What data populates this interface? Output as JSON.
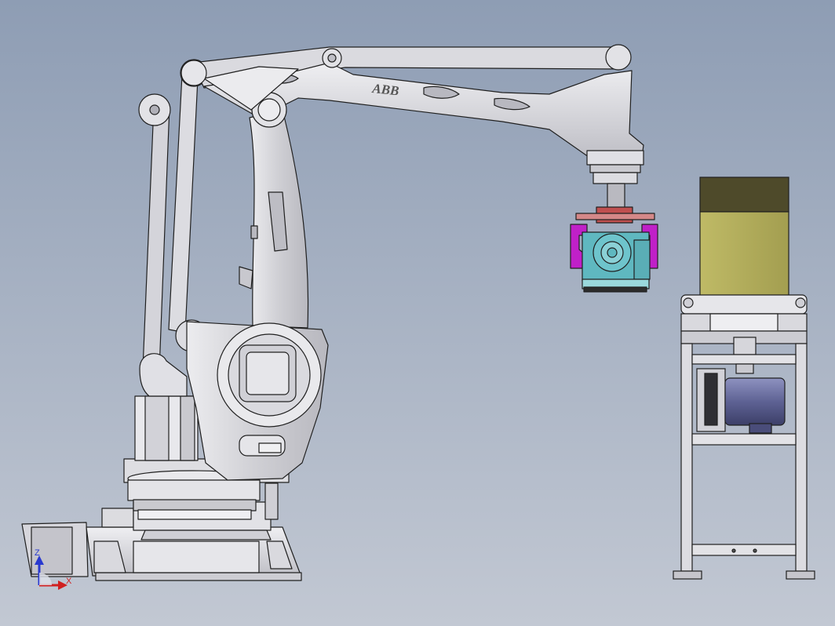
{
  "scene": {
    "brand_logo_text": "ABB",
    "triad": {
      "z": "Z",
      "x": "X"
    },
    "colors": {
      "bg_top": "#8e9db4",
      "bg_bottom": "#c2c8d3",
      "metal": "#d9d9de",
      "metal_dark": "#9a9aa2",
      "line": "#202020",
      "gripper_teal": "#5fb8c0",
      "gripper_magenta": "#c020c8",
      "gripper_red": "#c05050",
      "bag_top": "#4e4a2a",
      "bag_body": "#b3ae5c",
      "motor_blue": "#6a6f9e",
      "axis_z": "#2a3ad0",
      "axis_x": "#d02020"
    }
  }
}
